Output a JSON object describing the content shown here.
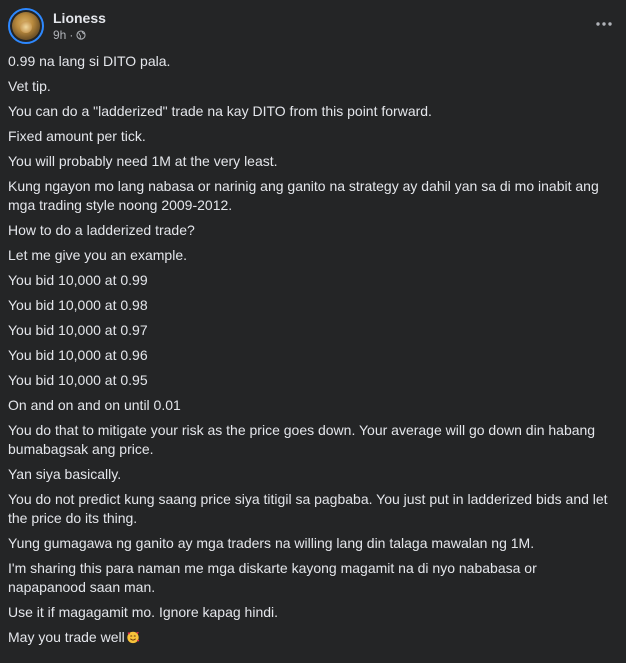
{
  "post": {
    "author": "Lioness",
    "time": "9h",
    "separator": "·",
    "privacy_icon": "globe-icon",
    "menu_icon": "more-horizontal-icon",
    "paragraphs": [
      "0.99 na lang si DITO pala.",
      "Vet tip.",
      "You can do a \"ladderized\" trade na kay DITO from this point forward.",
      "Fixed amount per tick.",
      "You will probably need 1M at the very least.",
      "Kung ngayon mo lang nabasa or narinig ang ganito na strategy ay dahil yan sa di mo inabit ang mga trading style noong 2009-2012.",
      "How to do a ladderized trade?",
      "Let me give you an example.",
      "You bid 10,000 at 0.99",
      "You bid 10,000 at 0.98",
      "You bid 10,000 at 0.97",
      "You bid 10,000 at 0.96",
      "You bid 10,000 at 0.95",
      "On and on and on until 0.01",
      "You do that to mitigate your risk as the price goes down. Your average will go down din habang bumabagsak ang price.",
      "Yan siya basically.",
      "You do not predict kung saang price siya titigil sa pagbaba. You just put in ladderized bids and let the price do its thing.",
      "Yung gumagawa ng ganito ay mga traders na willing lang din talaga mawalan ng 1M.",
      "I'm sharing this para naman me mga diskarte kayong magamit na di nyo nababasa or napapanood saan man.",
      "Use it if magagamit mo. Ignore kapag hindi."
    ],
    "last_line": "May you trade well",
    "last_emoji": "smiling-face-with-hearts-icon"
  },
  "colors": {
    "background": "#242526",
    "text_primary": "#e4e6eb",
    "text_secondary": "#b0b3b8",
    "avatar_ring": "#2d88ff"
  }
}
